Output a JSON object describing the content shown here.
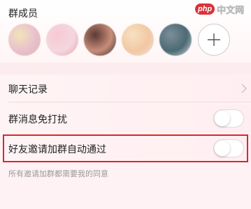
{
  "watermark": {
    "badge": "php",
    "text": "中文网"
  },
  "members": {
    "title": "群成员",
    "avatars": [
      {
        "name": "member-1",
        "colors": [
          "#f2e3b8",
          "#e9c0cf",
          "#d9b9a7"
        ]
      },
      {
        "name": "member-2",
        "colors": [
          "#f7c9d4",
          "#f4d7df",
          "#e7a0b0"
        ]
      },
      {
        "name": "member-3",
        "colors": [
          "#5a3a35",
          "#c98d7a",
          "#2b2b2b"
        ]
      },
      {
        "name": "member-4",
        "colors": [
          "#f6e2c2",
          "#f3c7a3",
          "#e8e3dd"
        ]
      },
      {
        "name": "member-5",
        "colors": [
          "#7b8f9a",
          "#4c6a73",
          "#d7dde0"
        ]
      }
    ]
  },
  "settings": {
    "chat_history": "聊天记录",
    "mute": {
      "label": "群消息免打扰",
      "on": false
    },
    "auto_approve": {
      "label": "好友邀请加群自动通过",
      "on": false
    },
    "auto_approve_note": "所有邀请加群都需要我的同意"
  },
  "colors": {
    "highlight": "#d9262e",
    "background": "#fff2f4"
  }
}
